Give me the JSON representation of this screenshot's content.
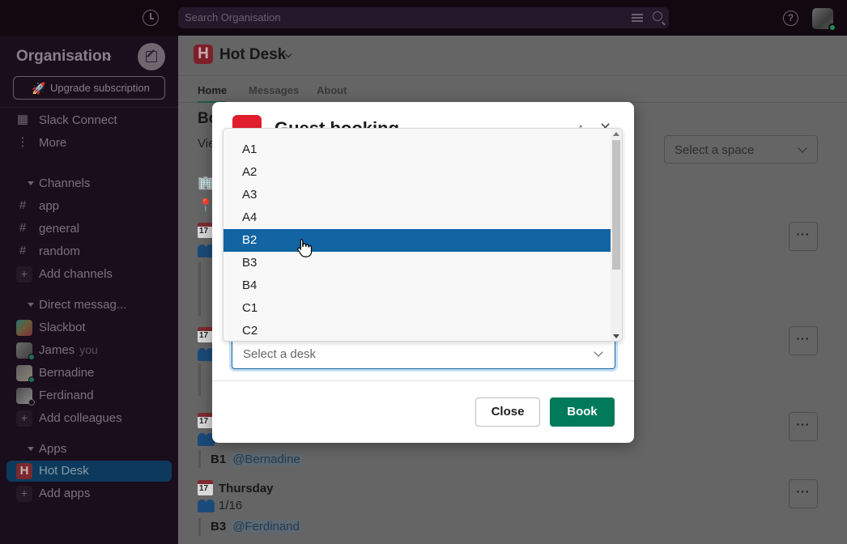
{
  "topbar": {
    "search_placeholder": "Search Organisation",
    "icons": [
      "history-icon",
      "filter-icon",
      "search-icon",
      "help-icon",
      "user-avatar"
    ]
  },
  "sidebar": {
    "org_name": "Organisation",
    "upgrade_label": "Upgrade subscription",
    "top_items": [
      {
        "label": "Slack Connect",
        "icon": "building-icon"
      },
      {
        "label": "More",
        "icon": "more-vertical-icon"
      }
    ],
    "channels_header": "Channels",
    "channels": [
      "app",
      "general",
      "random"
    ],
    "add_channels": "Add channels",
    "dm_header": "Direct messag...",
    "dms": [
      {
        "name": "Slackbot",
        "suffix": ""
      },
      {
        "name": "James",
        "suffix": "you"
      },
      {
        "name": "Bernadine",
        "suffix": ""
      },
      {
        "name": "Ferdinand",
        "suffix": ""
      }
    ],
    "add_colleagues": "Add colleagues",
    "apps_header": "Apps",
    "apps": [
      "Hot Desk"
    ],
    "add_apps": "Add apps",
    "colors": {
      "active_bg": "#0d3a5c"
    }
  },
  "main": {
    "app_title": "Hot Desk",
    "app_logo_letter": "H",
    "tabs": [
      "Home",
      "Messages",
      "About"
    ],
    "active_tab": "Home",
    "section_title": "Bo",
    "section_sub": "Vie",
    "space_select_placeholder": "Select a space",
    "more_button_label": "···",
    "days": [
      {
        "label": "",
        "count": "",
        "bookings": []
      },
      {
        "label": "",
        "count": "",
        "bookings": []
      },
      {
        "label": "",
        "count": "",
        "bookings": [
          {
            "desk": "B1",
            "user": "@Bernadine"
          }
        ]
      },
      {
        "label": "Thursday",
        "count": "1/16",
        "bookings": [
          {
            "desk": "B3",
            "user": "@Ferdinand"
          }
        ]
      }
    ],
    "calendar_day": "17"
  },
  "modal": {
    "title": "Guest booking",
    "desk_select_placeholder": "Select a desk",
    "close_label": "Close",
    "book_label": "Book",
    "colors": {
      "book_bg": "#007a5a",
      "logo": "#e01e2e",
      "focus": "#1264a3"
    }
  },
  "dropdown": {
    "options": [
      "A1",
      "A2",
      "A3",
      "A4",
      "B2",
      "B3",
      "B4",
      "C1",
      "C2"
    ],
    "selected": "B2",
    "colors": {
      "selected_bg": "#1264a3"
    }
  }
}
